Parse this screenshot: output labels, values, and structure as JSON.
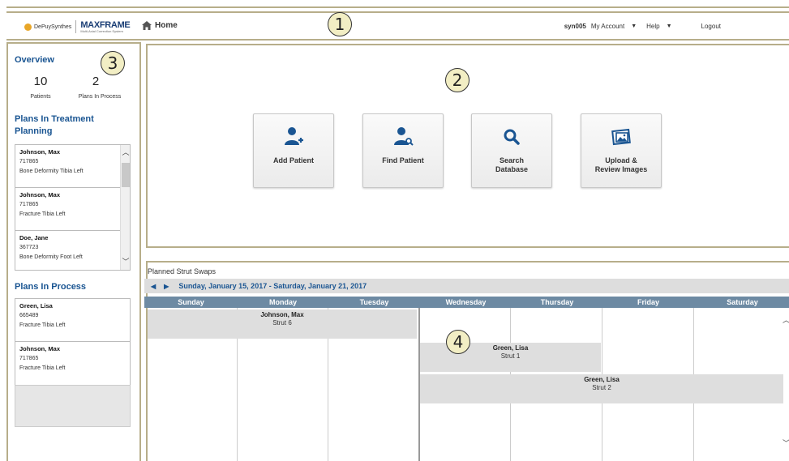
{
  "header": {
    "brand_left": "DePuySynthes",
    "brand_product": "MAXFRAME",
    "brand_tagline": "Multi-Axial Correction System",
    "home_label": "Home",
    "username": "syn005",
    "my_account_label": "My Account",
    "help_label": "Help",
    "logout_label": "Logout"
  },
  "callouts": {
    "c1": "1",
    "c2": "2",
    "c3": "3",
    "c4": "4"
  },
  "sidebar": {
    "overview_title": "Overview",
    "patients_count": "10",
    "patients_label": "Patients",
    "plans_in_process_count": "2",
    "plans_in_process_label": "Plans In Process",
    "treatment_title_line1": "Plans In Treatment",
    "treatment_title_line2": "Planning",
    "treatment_plans": [
      {
        "name": "Johnson, Max",
        "id": "717865",
        "condition": "Bone Deformity Tibia Left"
      },
      {
        "name": "Johnson, Max",
        "id": "717865",
        "condition": "Fracture Tibia Left"
      },
      {
        "name": "Doe, Jane",
        "id": "367723",
        "condition": "Bone Deformity Foot Left"
      }
    ],
    "process_title": "Plans In Process",
    "process_plans": [
      {
        "name": "Green, Lisa",
        "id": "665489",
        "condition": "Fracture Tibia Left"
      },
      {
        "name": "Johnson, Max",
        "id": "717865",
        "condition": "Fracture Tibia Left"
      }
    ]
  },
  "actions": [
    {
      "label": "Add Patient",
      "icon": "add-patient-icon"
    },
    {
      "label": "Find Patient",
      "icon": "find-patient-icon"
    },
    {
      "label": "Search\nDatabase",
      "icon": "search-icon"
    },
    {
      "label": "Upload &\nReview Images",
      "icon": "images-icon"
    }
  ],
  "calendar": {
    "title": "Planned Strut Swaps",
    "range": "Sunday, January 15, 2017 - Saturday, January 21, 2017",
    "days": [
      "Sunday",
      "Monday",
      "Tuesday",
      "Wednesday",
      "Thursday",
      "Friday",
      "Saturday"
    ],
    "events": [
      {
        "name": "Johnson, Max",
        "detail": "Strut 6"
      },
      {
        "name": "Green, Lisa",
        "detail": "Strut 1"
      },
      {
        "name": "Green, Lisa",
        "detail": "Strut 2"
      }
    ]
  },
  "colors": {
    "accent": "#1a5592",
    "frame": "#b7ae8a",
    "calendar_header": "#6d8aa3",
    "callout_fill": "#f2eec4"
  }
}
